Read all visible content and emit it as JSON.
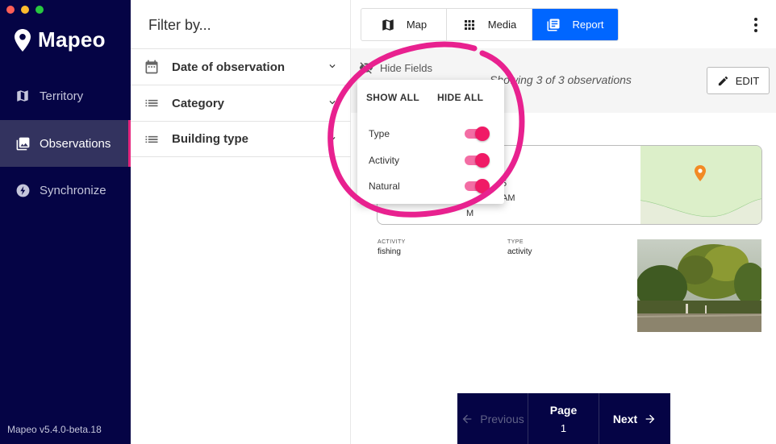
{
  "window": {
    "traffic_lights": [
      "close",
      "minimize",
      "zoom"
    ]
  },
  "sidebar": {
    "brand": "Mapeo",
    "items": [
      {
        "label": "Territory",
        "icon": "map-icon",
        "active": false
      },
      {
        "label": "Observations",
        "icon": "photo-album-icon",
        "active": true
      },
      {
        "label": "Synchronize",
        "icon": "bolt-icon",
        "active": false
      }
    ],
    "version": "Mapeo v5.4.0-beta.18"
  },
  "filter": {
    "title": "Filter by...",
    "rows": [
      {
        "label": "Date of observation",
        "icon": "calendar-icon"
      },
      {
        "label": "Category",
        "icon": "list-icon"
      },
      {
        "label": "Building type",
        "icon": "list-icon"
      }
    ]
  },
  "topbar": {
    "tabs": [
      {
        "label": "Map",
        "icon": "map-icon",
        "active": false
      },
      {
        "label": "Media",
        "icon": "grid-icon",
        "active": false
      },
      {
        "label": "Report",
        "icon": "report-icon",
        "active": true
      }
    ]
  },
  "report": {
    "hide_fields_label": "Hide Fields",
    "showing_text": "Showing 3 of 3 observations",
    "edit_label": "EDIT",
    "card_fragments": [
      "5",
      "AM",
      "M"
    ],
    "fields": [
      {
        "label": "ACTIVITY",
        "value": "fishing"
      },
      {
        "label": "TYPE",
        "value": "activity"
      }
    ]
  },
  "popover": {
    "show_all": "SHOW ALL",
    "hide_all": "HIDE ALL",
    "fields": [
      {
        "label": "Type",
        "enabled": true
      },
      {
        "label": "Activity",
        "enabled": true
      },
      {
        "label": "Natural",
        "enabled": true
      }
    ]
  },
  "pagination": {
    "previous": "Previous",
    "page_label": "Page",
    "page_number": "1",
    "next": "Next"
  },
  "colors": {
    "sidebar_bg": "#050445",
    "accent_blue": "#0066ff",
    "accent_pink": "#e5257d",
    "toggle_on": "#f01a66"
  }
}
